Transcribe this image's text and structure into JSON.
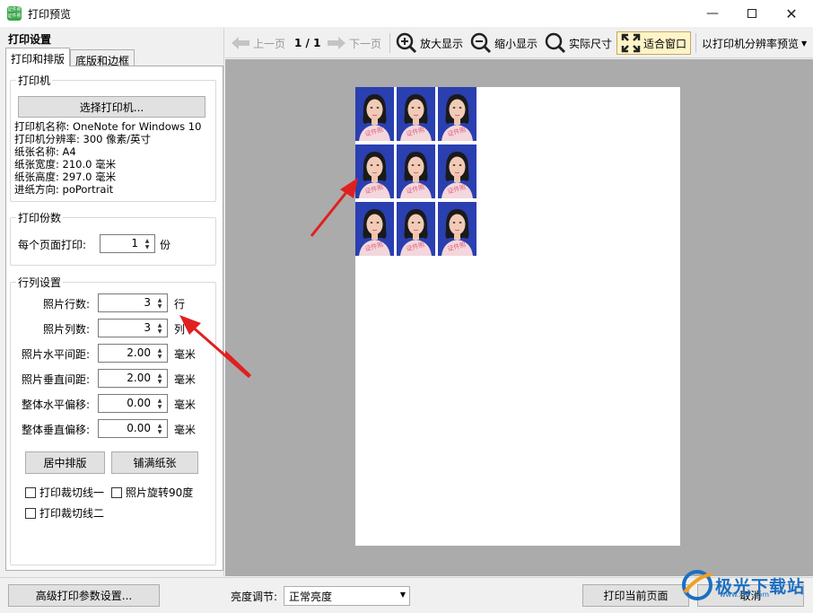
{
  "window": {
    "title": "打印预览",
    "icon_name": "app-logo-icon",
    "icon_text_top": "证件照",
    "icon_text_bottom": "证件照",
    "controls": [
      "minimize-icon",
      "maximize-icon",
      "close-icon"
    ]
  },
  "left_panel": {
    "title": "打印设置",
    "tabs": [
      {
        "label": "打印和排版",
        "active": true
      },
      {
        "label": "底版和边框",
        "active": false
      }
    ],
    "printer_group": {
      "legend": "打印机",
      "select_button": "选择打印机...",
      "info": [
        "打印机名称: OneNote for Windows 10",
        "打印机分辨率: 300 像素/英寸",
        "纸张名称: A4",
        "纸张宽度: 210.0 毫米",
        "纸张高度: 297.0 毫米",
        "进纸方向: poPortrait"
      ]
    },
    "copies_group": {
      "legend": "打印份数",
      "label": "每个页面打印:",
      "value": "1",
      "unit": "份"
    },
    "layout_group": {
      "legend": "行列设置",
      "rows": [
        {
          "label": "照片行数:",
          "value": "3",
          "unit": "行"
        },
        {
          "label": "照片列数:",
          "value": "3",
          "unit": "列"
        },
        {
          "label": "照片水平间距:",
          "value": "2.00",
          "unit": "毫米"
        },
        {
          "label": "照片垂直间距:",
          "value": "2.00",
          "unit": "毫米"
        },
        {
          "label": "整体水平偏移:",
          "value": "0.00",
          "unit": "毫米"
        },
        {
          "label": "整体垂直偏移:",
          "value": "0.00",
          "unit": "毫米"
        }
      ],
      "center_button": "居中排版",
      "fill_button": "铺满纸张",
      "checkboxes": [
        {
          "label": "打印裁切线一",
          "checked": false
        },
        {
          "label": "照片旋转90度",
          "checked": false
        },
        {
          "label": "打印裁切线二",
          "checked": false
        }
      ]
    }
  },
  "toolbar": {
    "prev_page": "上一页",
    "page_indicator": "1 / 1",
    "next_page": "下一页",
    "zoom_in": "放大显示",
    "zoom_out": "缩小显示",
    "actual_size": "实际尺寸",
    "fit_window": "适合窗口",
    "printer_res_preview": "以打印机分辨率预览"
  },
  "preview": {
    "rows": 3,
    "cols": 3,
    "stamp_text": "证件照",
    "photo_bg": "#2a3fb0"
  },
  "bottom": {
    "advanced_button": "高级打印参数设置...",
    "brightness_label": "亮度调节:",
    "brightness_value": "正常亮度",
    "print_button": "打印当前页面",
    "cancel_button": "取消"
  },
  "watermark": {
    "text": "极光下载站",
    "url": "www.xz7.com"
  },
  "colors": {
    "accent_blue": "#1b6fc2",
    "arrow_red": "#e02020",
    "preview_gray": "#ababab"
  }
}
